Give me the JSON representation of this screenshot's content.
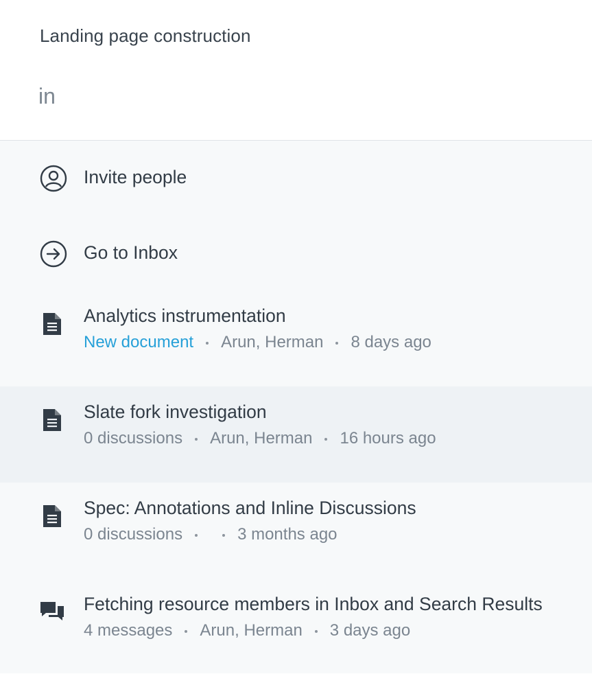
{
  "header": {
    "context_title": "Landing page construction",
    "search_value": "in",
    "search_placeholder": ""
  },
  "results": [
    {
      "kind": "action",
      "icon": "person-circle-icon",
      "label": "Invite people"
    },
    {
      "kind": "action",
      "icon": "arrow-right-circle-icon",
      "label": "Go to Inbox"
    },
    {
      "kind": "document",
      "icon": "document-icon",
      "title": "Analytics instrumentation",
      "status": "New document",
      "people": "Arun, Herman",
      "time": "8 days ago"
    },
    {
      "kind": "document",
      "icon": "document-icon",
      "title": "Slate fork investigation",
      "status": "0 discussions",
      "people": "Arun, Herman",
      "time": "16 hours ago",
      "selected": true
    },
    {
      "kind": "document",
      "icon": "document-icon",
      "title": "Spec: Annotations and Inline Discussions",
      "status": "0 discussions",
      "people": "",
      "time": "3 months ago"
    },
    {
      "kind": "conversation",
      "icon": "chat-bubbles-icon",
      "title": "Fetching resource members in Inbox and Search Results",
      "status": "4 messages",
      "people": "Arun, Herman",
      "time": "3 days ago"
    }
  ],
  "colors": {
    "accent": "#26a0d8",
    "selected_row": "#eef2f5",
    "results_bg": "#f7f9fa",
    "icon": "#323c46"
  }
}
